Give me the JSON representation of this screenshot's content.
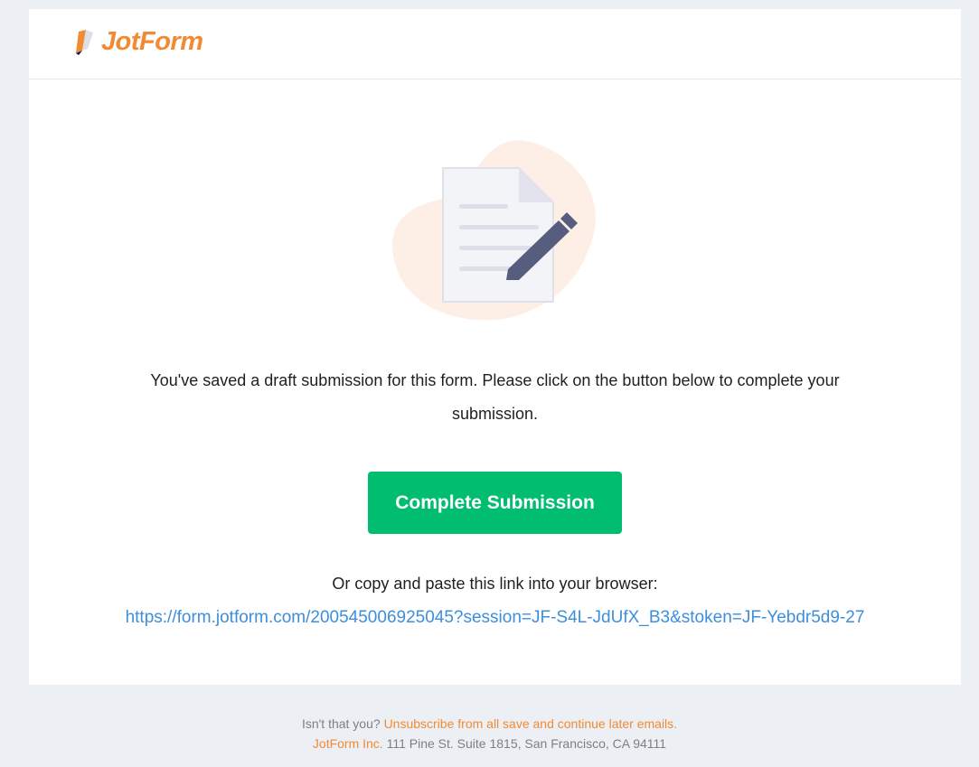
{
  "brand": {
    "name": "JotForm",
    "color": "#f28a33"
  },
  "illustration": {
    "icon": "document-edit-icon"
  },
  "message": "You've saved a draft submission for this form. Please click on the button below to complete your submission.",
  "cta": {
    "label": "Complete Submission",
    "color": "#01bd6f"
  },
  "copy_instructions": "Or copy and paste this link into your browser:",
  "link": {
    "text": "https://form.jotform.com/200545006925045?session=JF-S4L-JdUfX_B3&stoken=JF-Yebdr5d9-27",
    "color": "#3d8fdc"
  },
  "footer": {
    "question": "Isn't that you?",
    "unsubscribe_label": "Unsubscribe from all save and continue later emails.",
    "company": "JotForm Inc.",
    "address": "111 Pine St. Suite 1815, San Francisco, CA 94111"
  }
}
